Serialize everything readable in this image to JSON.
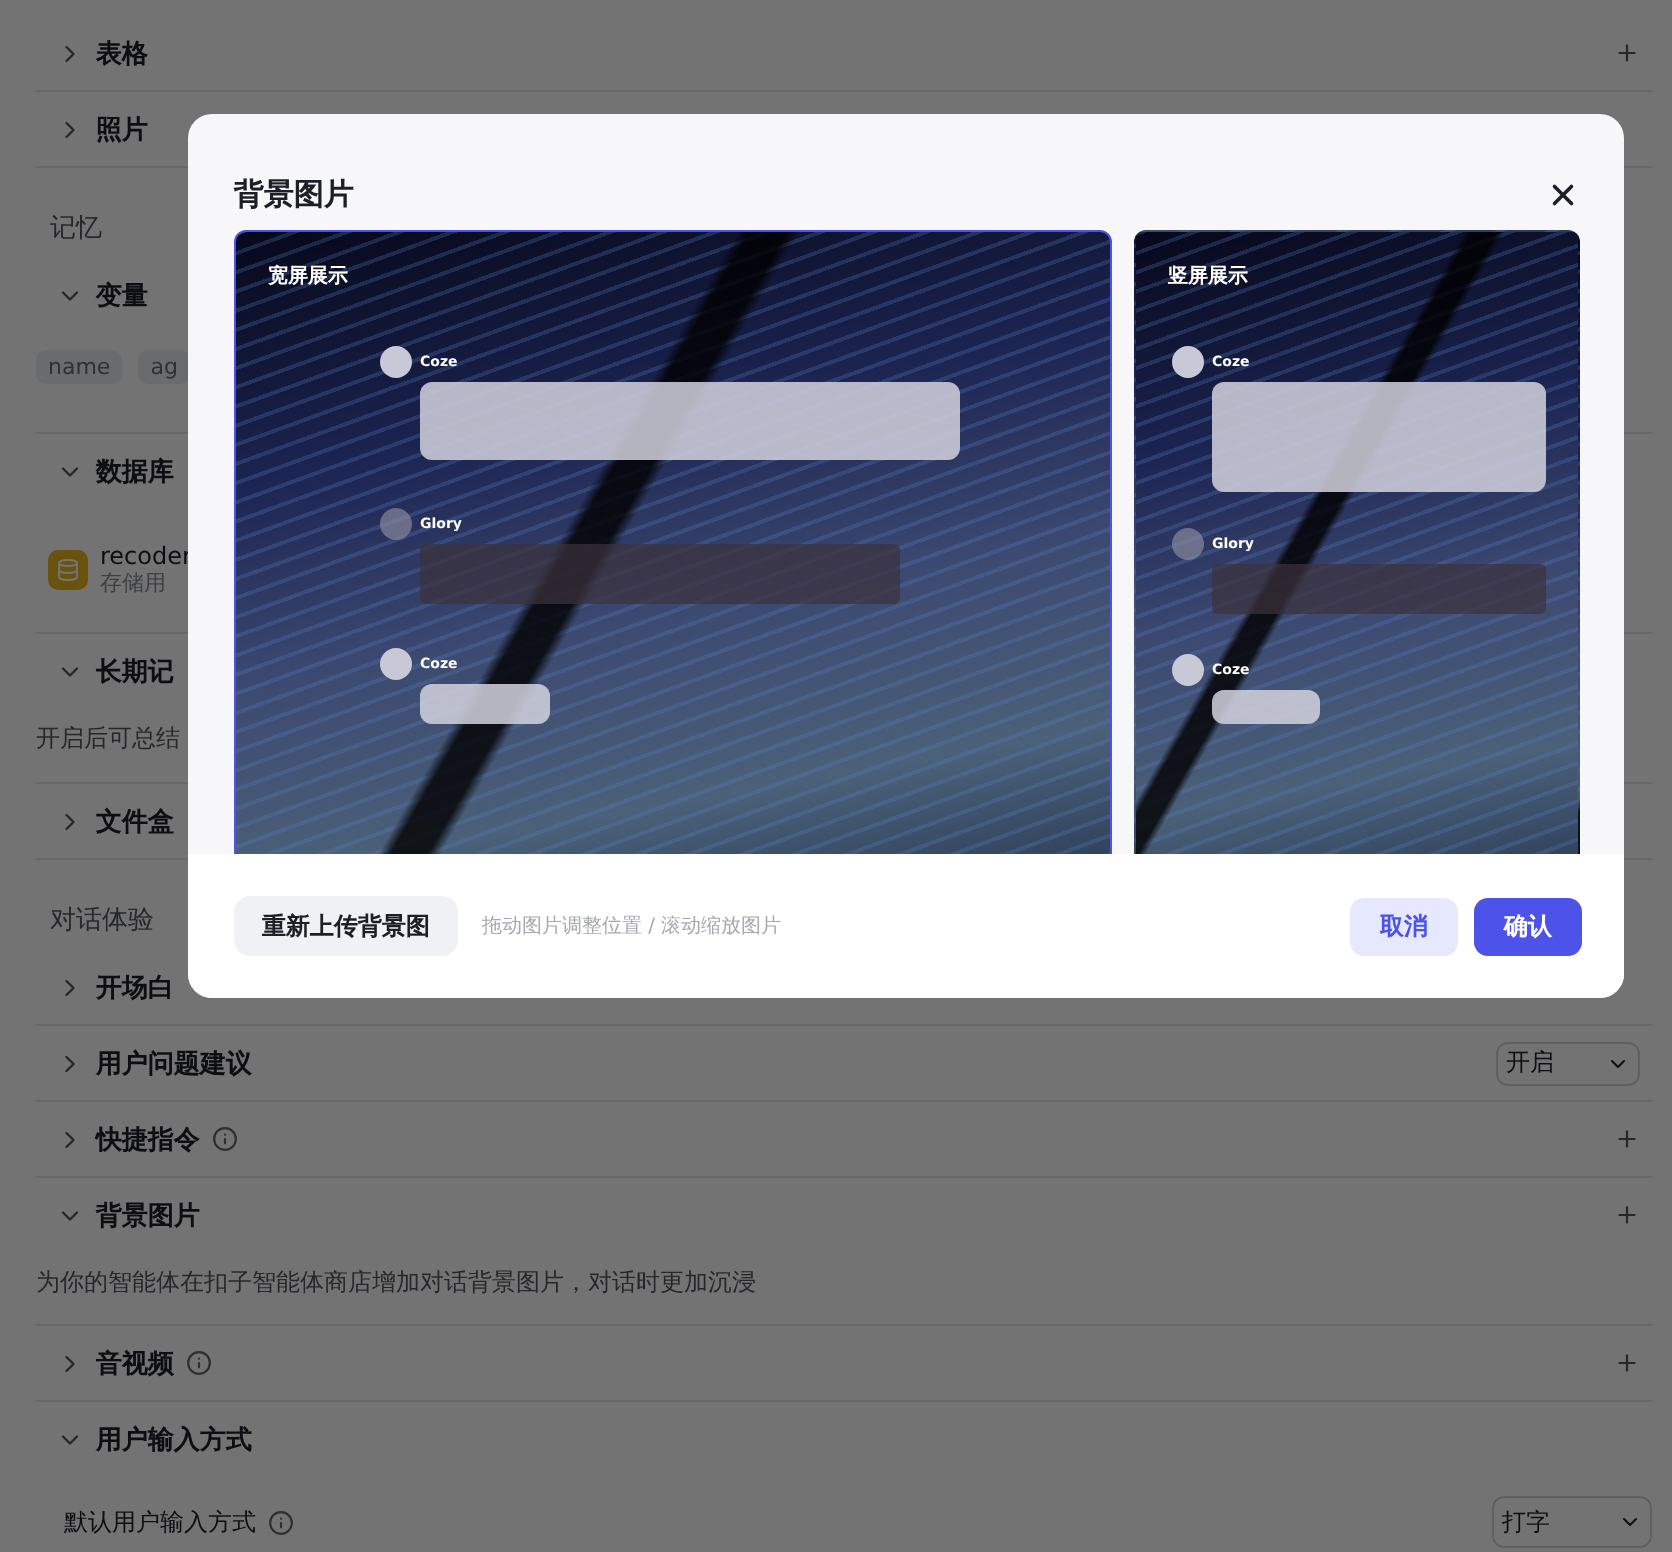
{
  "page": {
    "items": [
      {
        "kind": "row",
        "title": "表格",
        "expanded": false,
        "info": false,
        "add": true
      },
      {
        "kind": "row",
        "title": "照片",
        "expanded": false,
        "info": false,
        "add": false
      },
      {
        "kind": "heading",
        "title": "记忆"
      },
      {
        "kind": "row",
        "title": "变量",
        "expanded": true,
        "info": false,
        "add": false
      },
      {
        "kind": "chips",
        "chips": [
          "name",
          "ag"
        ]
      },
      {
        "kind": "row",
        "title": "数据库",
        "expanded": true,
        "info": false,
        "add": false
      },
      {
        "kind": "db",
        "name": "recoder",
        "desc": "存储用"
      },
      {
        "kind": "row",
        "title": "长期记",
        "expanded": true,
        "info": false,
        "add": false
      },
      {
        "kind": "desc",
        "text": "开启后可总结"
      },
      {
        "kind": "row",
        "title": "文件盒",
        "expanded": false,
        "info": false,
        "add": false
      },
      {
        "kind": "heading",
        "title": "对话体验"
      },
      {
        "kind": "row",
        "title": "开场白",
        "expanded": false,
        "info": false,
        "add": false
      },
      {
        "kind": "row",
        "title": "用户问题建议",
        "expanded": false,
        "info": false,
        "add": false,
        "select": "开启"
      },
      {
        "kind": "row",
        "title": "快捷指令",
        "expanded": false,
        "info": true,
        "add": true
      },
      {
        "kind": "row",
        "title": "背景图片",
        "expanded": true,
        "info": false,
        "add": true
      },
      {
        "kind": "desc",
        "text": "为你的智能体在扣子智能体商店增加对话背景图片，对话时更加沉浸"
      },
      {
        "kind": "row",
        "title": "音视频",
        "expanded": false,
        "info": true,
        "add": true
      },
      {
        "kind": "row",
        "title": "用户输入方式",
        "expanded": true,
        "info": false,
        "add": false
      },
      {
        "kind": "setting",
        "title": "默认用户输入方式",
        "info": true,
        "select": "打字"
      }
    ]
  },
  "dialog": {
    "title": "背景图片",
    "previews": [
      {
        "kind": "wide",
        "label": "宽屏展示",
        "selected": true,
        "messages": [
          {
            "name": "Coze",
            "kind": "bot"
          },
          {
            "name": "Glory",
            "kind": "user"
          },
          {
            "name": "Coze",
            "kind": "bot"
          }
        ]
      },
      {
        "kind": "tall",
        "label": "竖屏展示",
        "selected": false,
        "messages": [
          {
            "name": "Coze",
            "kind": "bot"
          },
          {
            "name": "Glory",
            "kind": "user"
          },
          {
            "name": "Coze",
            "kind": "bot"
          }
        ]
      }
    ],
    "reupload": "重新上传背景图",
    "hint": "拖动图片调整位置 / 滚动缩放图片",
    "cancel": "取消",
    "confirm": "确认"
  }
}
